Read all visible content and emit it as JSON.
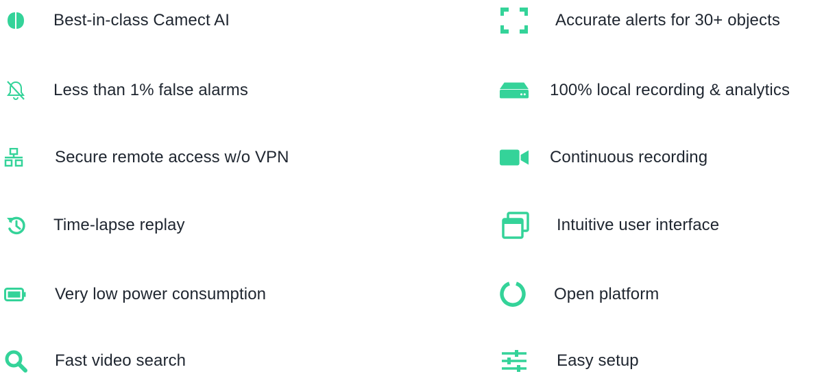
{
  "accent_color": "#34d399",
  "features_left": [
    {
      "icon": "brain-icon",
      "label": "Best-in-class Camect AI"
    },
    {
      "icon": "bell-slash-icon",
      "label": "Less than 1% false alarms"
    },
    {
      "icon": "network-icon",
      "label": "Secure remote access w/o VPN"
    },
    {
      "icon": "history-icon",
      "label": "Time-lapse replay"
    },
    {
      "icon": "battery-icon",
      "label": "Very low power consumption"
    },
    {
      "icon": "search-icon",
      "label": "Fast video search"
    }
  ],
  "features_right": [
    {
      "icon": "scan-frame-icon",
      "label": "Accurate alerts for 30+ objects"
    },
    {
      "icon": "hard-drive-icon",
      "label": "100% local recording & analytics"
    },
    {
      "icon": "video-camera-icon",
      "label": "Continuous recording"
    },
    {
      "icon": "windows-icon",
      "label": "Intuitive user interface"
    },
    {
      "icon": "circle-notch-icon",
      "label": "Open platform"
    },
    {
      "icon": "sliders-icon",
      "label": "Easy setup"
    }
  ]
}
